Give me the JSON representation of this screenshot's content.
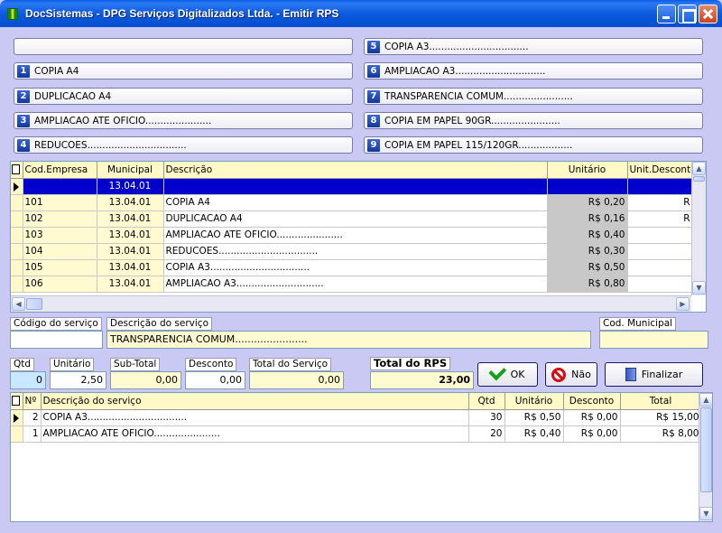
{
  "window": {
    "title": "DocSistemas - DPG Serviços Digitalizados Ltda. - Emitir RPS"
  },
  "shortcuts": [
    {
      "num": "1",
      "label": "COPIA A4"
    },
    {
      "num": "2",
      "label": "DUPLICACAO A4"
    },
    {
      "num": "3",
      "label": "AMPLIACAO ATE OFICIO......................"
    },
    {
      "num": "4",
      "label": "REDUCOES................................."
    },
    {
      "num": "5",
      "label": "COPIA A3................................."
    },
    {
      "num": "6",
      "label": "AMPLIACAO A3.............................."
    },
    {
      "num": "7",
      "label": "TRANSPARENCIA COMUM......................."
    },
    {
      "num": "8",
      "label": "COPIA EM PAPEL 90GR......................."
    },
    {
      "num": "9",
      "label": "COPIA EM PAPEL 115/120GR.................."
    }
  ],
  "catalog": {
    "columns": [
      "Cod.Empresa",
      "Municipal",
      "Descrição",
      "Unitário",
      "Unit.Desconto"
    ],
    "rows": [
      {
        "cod": "",
        "mun": "13.04.01",
        "desc": "",
        "unit": "",
        "udesc": ""
      },
      {
        "cod": "101",
        "mun": "13.04.01",
        "desc": "COPIA A4",
        "unit": "R$ 0,20",
        "udesc": "R"
      },
      {
        "cod": "102",
        "mun": "13.04.01",
        "desc": "DUPLICACAO A4",
        "unit": "R$ 0,16",
        "udesc": "R"
      },
      {
        "cod": "103",
        "mun": "13.04.01",
        "desc": "AMPLIACAO ATE OFICIO......................",
        "unit": "R$ 0,40",
        "udesc": ""
      },
      {
        "cod": "104",
        "mun": "13.04.01",
        "desc": "REDUCOES.................................",
        "unit": "R$ 0,30",
        "udesc": ""
      },
      {
        "cod": "105",
        "mun": "13.04.01",
        "desc": "COPIA A3.................................",
        "unit": "R$ 0,50",
        "udesc": ""
      },
      {
        "cod": "106",
        "mun": "13.04.01",
        "desc": "AMPLIACAO A3.............................",
        "unit": "R$ 0,80",
        "udesc": ""
      }
    ]
  },
  "form": {
    "codigo_label": "Código do serviço",
    "codigo_value": "",
    "descricao_label": "Descrição do serviço",
    "descricao_value": "TRANSPARENCIA COMUM.......................",
    "codmun_label": "Cod. Municipal",
    "codmun_value": "",
    "qtd_label": "Qtd",
    "qtd_value": "0",
    "unitario_label": "Unitário",
    "unitario_value": "2,50",
    "subtotal_label": "Sub-Total",
    "subtotal_value": "0,00",
    "desconto_label": "Desconto",
    "desconto_value": "0,00",
    "totalserv_label": "Total do Serviço",
    "totalserv_value": "0,00",
    "totalrps_label": "Total do RPS",
    "totalrps_value": "23,00"
  },
  "actions": {
    "ok": "OK",
    "nao": "Não",
    "finalizar": "Finalizar"
  },
  "items": {
    "columns": [
      "Nº",
      "Descrição do serviço",
      "Qtd",
      "Unitário",
      "Desconto",
      "Total"
    ],
    "rows": [
      {
        "n": "2",
        "desc": "COPIA A3.................................",
        "qtd": "30",
        "unit": "R$ 0,50",
        "desc2": "R$ 0,00",
        "total": "R$ 15,00"
      },
      {
        "n": "1",
        "desc": "AMPLIACAO ATE OFICIO......................",
        "qtd": "20",
        "unit": "R$ 0,40",
        "desc2": "R$ 0,00",
        "total": "R$ 8,00"
      }
    ]
  }
}
